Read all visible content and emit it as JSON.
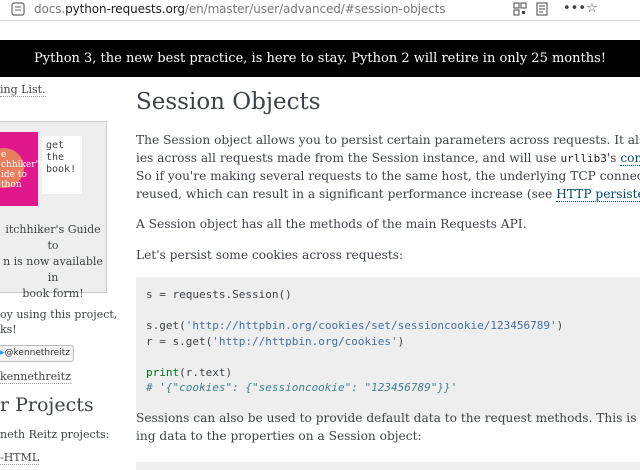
{
  "browser": {
    "url_prefix": "docs.",
    "url_domain": "python-requests.org",
    "url_path": "/en/master/user/advanced/#session-objects",
    "qr_icon": "qr-icon",
    "reader_icon": "reader-icon",
    "menu_icon": "ellipsis-icon",
    "star_icon": "star-icon"
  },
  "banner": {
    "text": "Python 3, the new best practice, is here to stay. Python 2 will retire in only 25 months!"
  },
  "sidebar": {
    "mailing_link": "ing List.",
    "promo": {
      "cover_lines": [
        "e",
        "chhiker's",
        "ide to",
        "thon"
      ],
      "get_text": "get the book!",
      "caption_lines": [
        "itchhiker's Guide to",
        "n is now available in",
        "book form!"
      ]
    },
    "enjoy_lines": [
      "oy using this project,",
      "ks!"
    ],
    "follow_badge": "@kennethreitz",
    "handle_link": "kennethreitz",
    "projects_heading": "r Projects",
    "projects_intro": "neth Reitz projects:",
    "projects_link": "-HTML"
  },
  "main": {
    "title": "Session Objects",
    "p1": {
      "l1": "The Session object allows you to persist certain parameters across requests. It also persists",
      "l2_pre": "ies across all requests made from the Session instance, and will use ",
      "l2_code": "urllib3",
      "l2_mid": "'s ",
      "l2_link": "connection p",
      "l3": "So if you're making several requests to the same host, the underlying TCP connection will b",
      "l4_pre": "reused, which can result in a significant performance increase (see ",
      "l4_link": "HTTP persistent conne"
    },
    "p2": "A Session object has all the methods of the main Requests API.",
    "p3": "Let's persist some cookies across requests:",
    "code": {
      "l1": "s = requests.Session()",
      "l3_pre": "s.get(",
      "l3_str": "'http://httpbin.org/cookies/set/sessioncookie/123456789'",
      "l3_post": ")",
      "l4_pre": "r = s.get(",
      "l4_str": "'http://httpbin.org/cookies'",
      "l4_post": ")",
      "l6_kw": "print",
      "l6_rest": "(r.text)",
      "l7_comment": "# '{\"cookies\": {\"sessioncookie\": \"123456789\"}}'"
    },
    "p4": {
      "l1": "Sessions can also be used to provide default data to the request methods. This is done by p",
      "l2": "ing data to the properties on a Session object:"
    }
  }
}
